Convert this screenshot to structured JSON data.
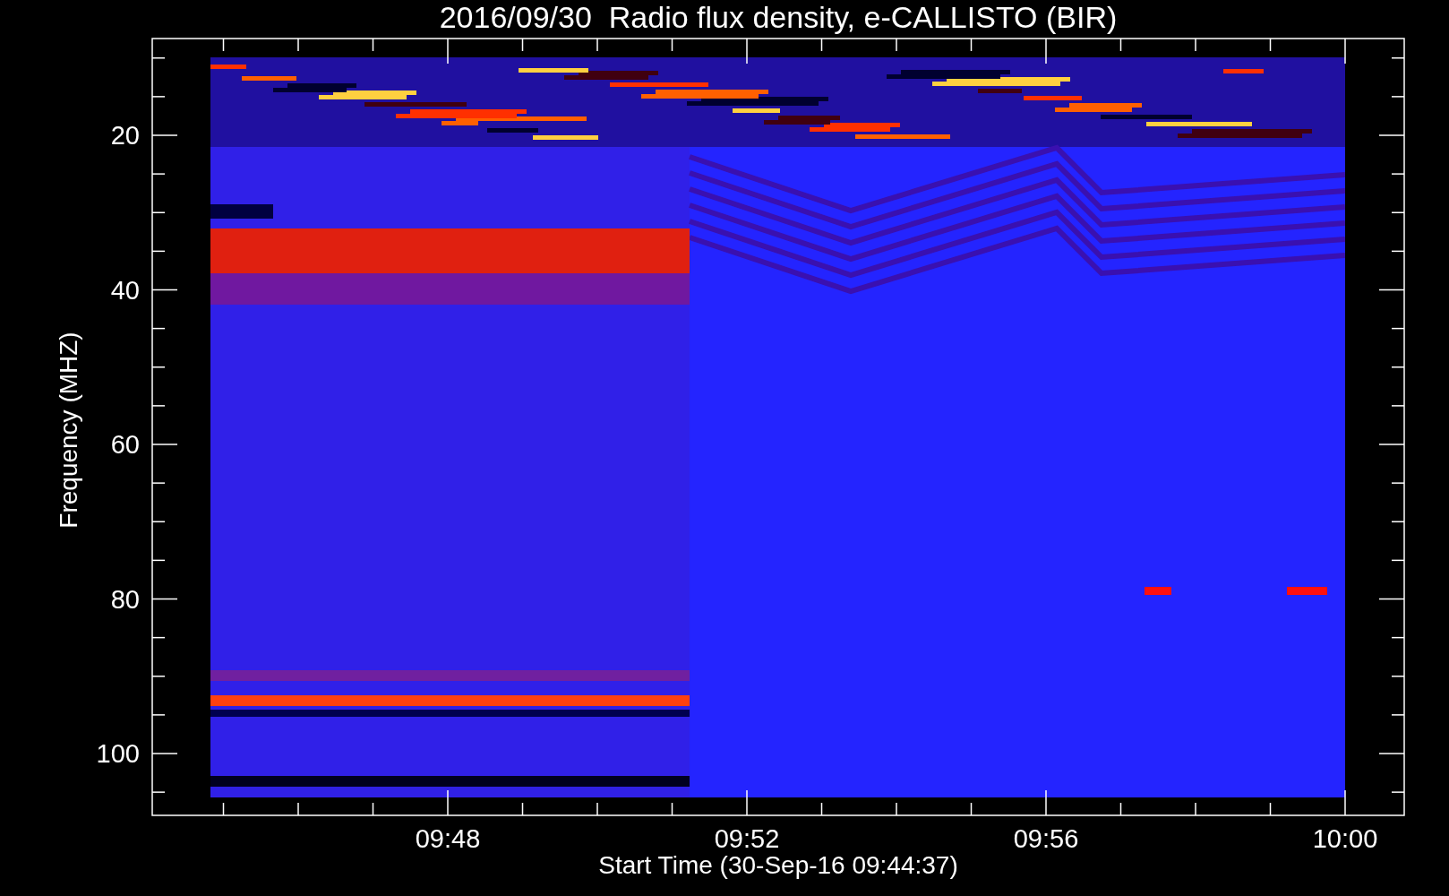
{
  "title": "2016/09/30  Radio flux density, e-CALLISTO (BIR)",
  "y_axis": {
    "label": "Frequency (MHZ)",
    "ticks": [
      "20",
      "40",
      "60",
      "80",
      "100"
    ]
  },
  "x_axis": {
    "label": "Start Time (30-Sep-16 09:44:37)",
    "ticks": [
      "09:48",
      "09:52",
      "09:56",
      "10:00"
    ]
  }
}
